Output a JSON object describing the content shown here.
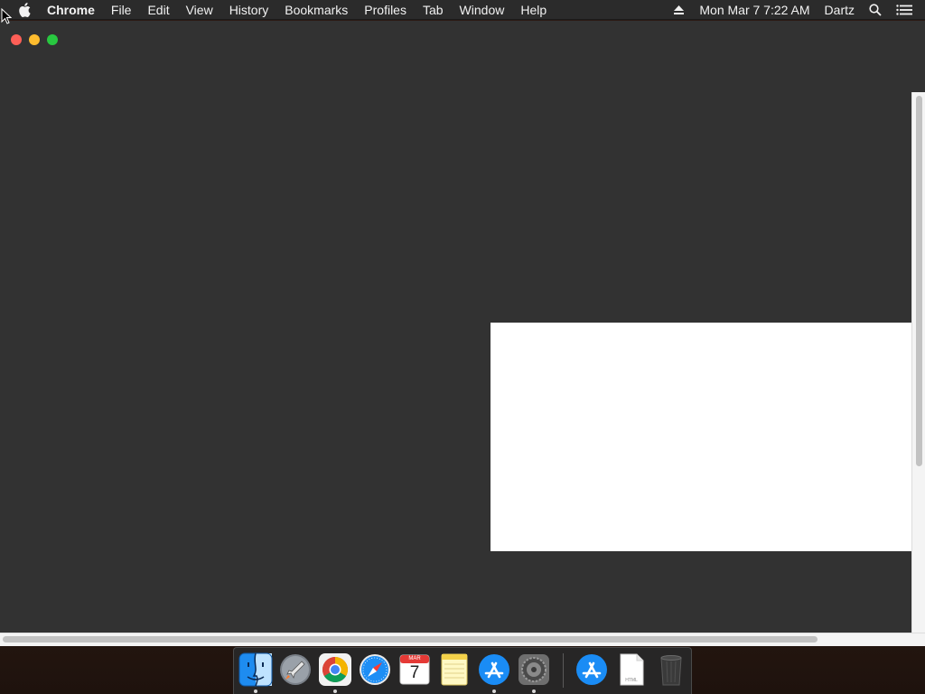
{
  "menubar": {
    "app_name": "Chrome",
    "items": [
      "File",
      "Edit",
      "View",
      "History",
      "Bookmarks",
      "Profiles",
      "Tab",
      "Window",
      "Help"
    ],
    "datetime": "Mon Mar 7  7:22 AM",
    "user": "Dartz",
    "icons": [
      "apple-icon",
      "eject-icon",
      "spotlight-search-icon",
      "notification-center-icon"
    ]
  },
  "window": {
    "traffic_lights": {
      "close": "#fe5f57",
      "minimize": "#febc2e",
      "maximize": "#28c840"
    },
    "background": "#323232"
  },
  "dock": {
    "items": [
      {
        "name": "Finder",
        "icon": "finder-icon",
        "running": true
      },
      {
        "name": "Launchpad",
        "icon": "launchpad-icon",
        "running": false
      },
      {
        "name": "Google Chrome",
        "icon": "chrome-icon",
        "running": true
      },
      {
        "name": "Safari",
        "icon": "safari-icon",
        "running": false
      },
      {
        "name": "Calendar",
        "icon": "calendar-icon",
        "running": false,
        "month": "MAR",
        "day": "7"
      },
      {
        "name": "Notes",
        "icon": "notes-icon",
        "running": false
      },
      {
        "name": "App Store",
        "icon": "app-store-icon",
        "running": true
      },
      {
        "name": "System Preferences",
        "icon": "system-preferences-icon",
        "running": true
      },
      {
        "name": "Downloads",
        "icon": "app-store-download-icon",
        "running": false
      },
      {
        "name": "HTML Document",
        "icon": "html-file-icon",
        "running": false,
        "label": "HTML"
      },
      {
        "name": "Trash",
        "icon": "trash-icon",
        "running": false
      }
    ]
  }
}
